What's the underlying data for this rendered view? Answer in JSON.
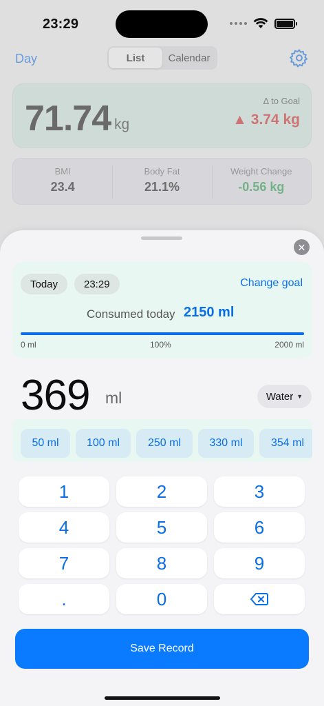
{
  "status_bar": {
    "time": "23:29"
  },
  "nav": {
    "day_label": "Day",
    "segments": [
      "List",
      "Calendar"
    ],
    "active_segment": "List"
  },
  "weight_card": {
    "value": "71.74",
    "unit": "kg",
    "goal_label": "Δ to Goal",
    "goal_delta": "▲ 3.74 kg"
  },
  "stats": [
    {
      "label": "BMI",
      "value": "23.4"
    },
    {
      "label": "Body Fat",
      "value": "21.1%"
    },
    {
      "label": "Weight Change",
      "value": "-0.56 kg"
    }
  ],
  "sheet": {
    "close_symbol": "✕",
    "intake": {
      "date_pill": "Today",
      "time_pill": "23:29",
      "change_goal": "Change goal",
      "consumed_label": "Consumed today",
      "consumed_value": "2150 ml",
      "progress_fraction": 1.0,
      "scale_min": "0 ml",
      "scale_mid": "100%",
      "scale_max": "2000 ml"
    },
    "amount": {
      "value": "369",
      "unit": "ml"
    },
    "drink_type": "Water",
    "presets": [
      "50 ml",
      "100 ml",
      "250 ml",
      "330 ml",
      "354 ml"
    ],
    "keypad": [
      "1",
      "2",
      "3",
      "4",
      "5",
      "6",
      "7",
      "8",
      "9",
      ".",
      "0"
    ],
    "save_label": "Save Record"
  },
  "colors": {
    "accent": "#0a6fe6",
    "save_button": "#0a7bff",
    "goal_red": "#d42020",
    "change_green": "#1f9a44"
  },
  "icons": [
    "wifi-icon",
    "battery-icon",
    "gear-icon",
    "close-icon",
    "backspace-icon",
    "chevron-down-icon"
  ]
}
